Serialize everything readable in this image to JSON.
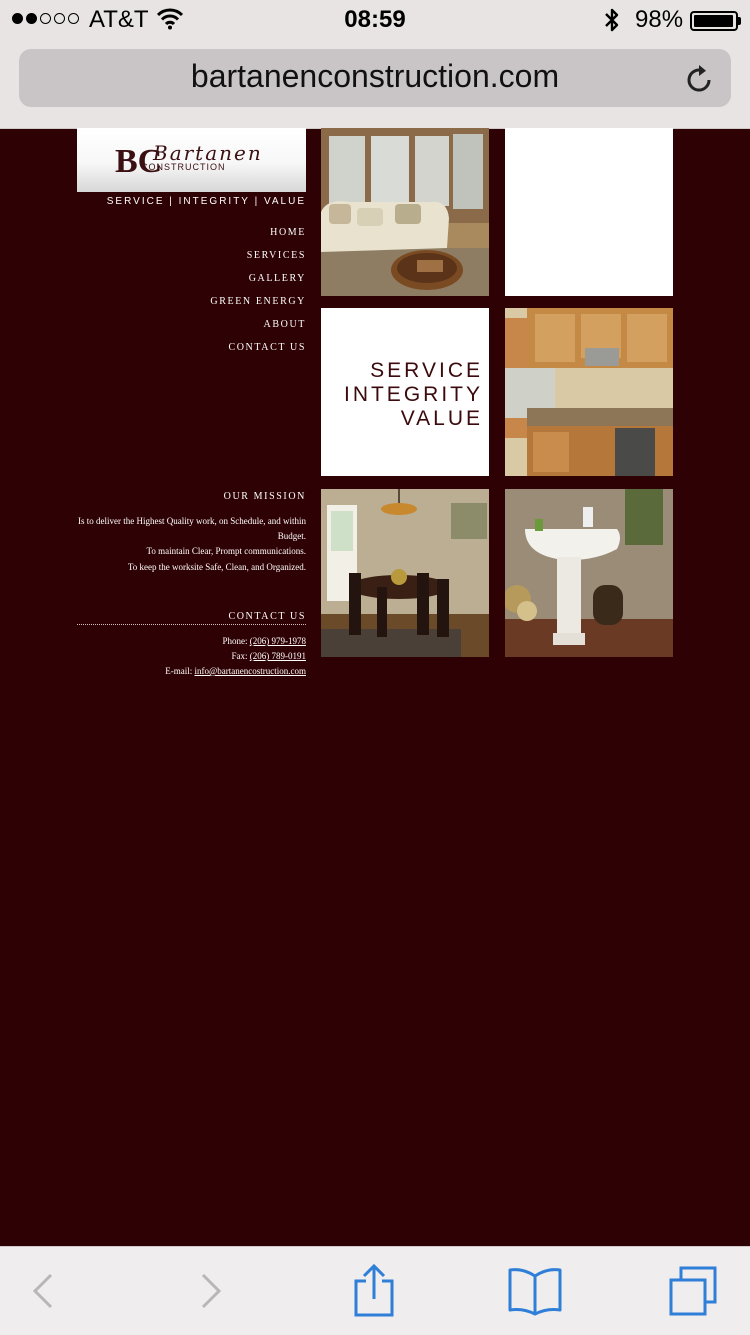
{
  "status_bar": {
    "carrier": "AT&T",
    "time": "08:59",
    "battery_percent": "98%",
    "signal_bars": 2,
    "signal_total": 5,
    "battery_level": 0.98,
    "icons": [
      "wifi-icon",
      "bluetooth-icon",
      "battery-icon"
    ]
  },
  "browser": {
    "url": "bartanenconstruction.com",
    "toolbar_icons": [
      "back-icon",
      "forward-icon",
      "share-icon",
      "bookmarks-icon",
      "tabs-icon"
    ],
    "tint": "#2f7fd9"
  },
  "site": {
    "logo_text": "Bartanen",
    "logo_initials": "BC",
    "logo_sub": "CONSTRUCTION",
    "tagline": "SERVICE | INTEGRITY | VALUE",
    "nav": [
      {
        "label": "HOME"
      },
      {
        "label": "SERVICES"
      },
      {
        "label": "GALLERY"
      },
      {
        "label": "GREEN ENERGY"
      },
      {
        "label": "ABOUT"
      },
      {
        "label": "CONTACT US"
      }
    ],
    "mission": {
      "title": "OUR MISSION",
      "lines": [
        "Is to deliver the Highest Quality work, on Schedule, and within Budget.",
        "To maintain Clear, Prompt communications.",
        "To keep the worksite Safe, Clean, and Organized."
      ]
    },
    "contact": {
      "title": "CONTACT US",
      "phone_label": "Phone:",
      "phone": "(206) 979-1978",
      "fax_label": "Fax:",
      "fax": "(206) 789-0191",
      "email_label": "E-mail:",
      "email": "info@bartanencostruction.com"
    },
    "feature_tile": [
      "SERVICE",
      "INTEGRITY",
      "VALUE"
    ],
    "colors": {
      "background": "#2e0204",
      "accent": "#3a0a0c"
    }
  }
}
